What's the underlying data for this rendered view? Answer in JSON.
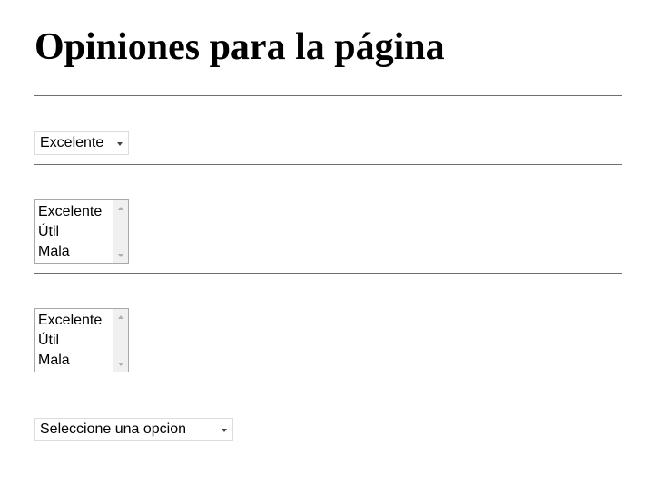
{
  "page": {
    "title": "Opiniones para la página"
  },
  "dropdown_rating": {
    "selected": "Excelente"
  },
  "listbox_1": {
    "options": [
      "Excelente",
      "Útil",
      "Mala"
    ]
  },
  "listbox_2": {
    "options": [
      "Excelente",
      "Útil",
      "Mala"
    ]
  },
  "dropdown_prompt": {
    "selected": "Seleccione una opcion"
  },
  "colors": {
    "background": "#ffffff",
    "text": "#000000",
    "divider": "#6f6f6f",
    "control_border": "#dcdcdc",
    "listbox_border": "#a8a8a8",
    "scrollbar_track": "#f0f0f0"
  },
  "icons": {
    "dropdown_arrow": "chevron-down-icon",
    "scroll_up": "scroll-up-arrow-icon",
    "scroll_down": "scroll-down-arrow-icon"
  }
}
